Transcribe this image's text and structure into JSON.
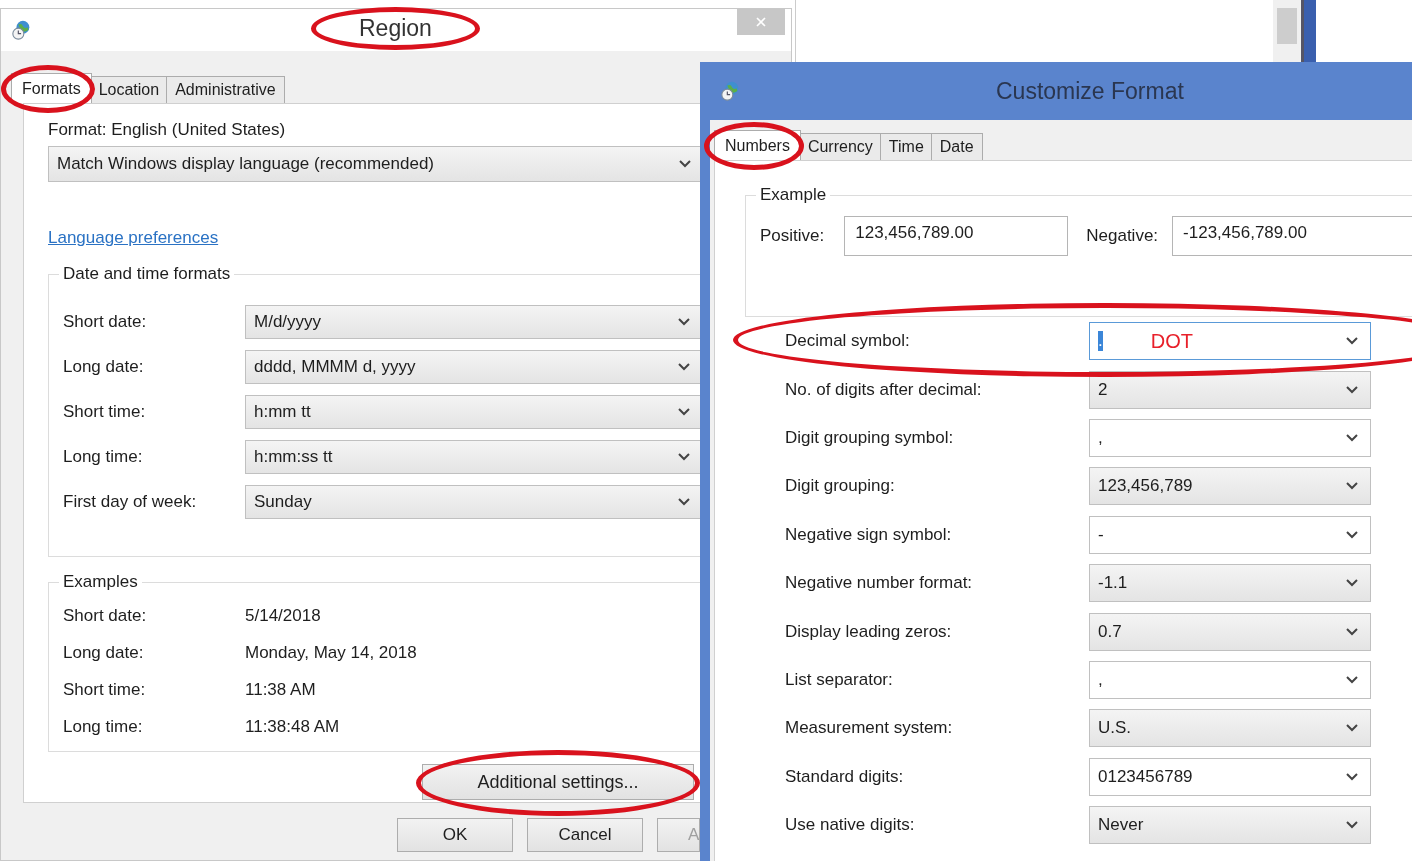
{
  "region_window": {
    "title": "Region",
    "title_circled": true,
    "tabs": [
      {
        "label": "Formats",
        "selected": true,
        "circled": true
      },
      {
        "label": "Location",
        "selected": false,
        "circled": false
      },
      {
        "label": "Administrative",
        "selected": false,
        "circled": false
      }
    ],
    "format_label": "Format: English (United States)",
    "format_value": "Match Windows display language (recommended)",
    "link": "Language preferences",
    "date_time_group": {
      "title": "Date and time formats",
      "rows": [
        {
          "label": "Short date:",
          "value": "M/d/yyyy"
        },
        {
          "label": "Long date:",
          "value": "dddd, MMMM d, yyyy"
        },
        {
          "label": "Short time:",
          "value": "h:mm tt"
        },
        {
          "label": "Long time:",
          "value": "h:mm:ss tt"
        },
        {
          "label": "First day of week:",
          "value": "Sunday"
        }
      ]
    },
    "examples_group": {
      "title": "Examples",
      "rows": [
        {
          "label": "Short date:",
          "value": "5/14/2018"
        },
        {
          "label": "Long date:",
          "value": "Monday, May 14, 2018"
        },
        {
          "label": "Short time:",
          "value": "11:38 AM"
        },
        {
          "label": "Long time:",
          "value": "11:38:48 AM"
        }
      ]
    },
    "additional_button": {
      "label": "Additional settings...",
      "circled": true
    },
    "buttons": [
      {
        "label": "OK",
        "disabled": false
      },
      {
        "label": "Cancel",
        "disabled": false
      },
      {
        "label": "A",
        "disabled": true
      }
    ]
  },
  "customize_window": {
    "title": "Customize Format",
    "tabs": [
      {
        "label": "Numbers",
        "selected": true,
        "circled": true
      },
      {
        "label": "Currency",
        "selected": false,
        "circled": false
      },
      {
        "label": "Time",
        "selected": false,
        "circled": false
      },
      {
        "label": "Date",
        "selected": false,
        "circled": false
      }
    ],
    "example_group": {
      "title": "Example",
      "positive_label": "Positive:",
      "positive_value": "123,456,789.00",
      "negative_label": "Negative:",
      "negative_value": "-123,456,789.00"
    },
    "settings": [
      {
        "label": "Decimal symbol:",
        "value": ".",
        "kind": "editable",
        "focused": true,
        "circled": true,
        "note": "DOT"
      },
      {
        "label": "No. of digits after decimal:",
        "value": "2",
        "kind": "list",
        "focused": false,
        "circled": false
      },
      {
        "label": "Digit grouping symbol:",
        "value": ",",
        "kind": "editable",
        "focused": false,
        "circled": false
      },
      {
        "label": "Digit grouping:",
        "value": "123,456,789",
        "kind": "list",
        "focused": false,
        "circled": false
      },
      {
        "label": "Negative sign symbol:",
        "value": "-",
        "kind": "editable",
        "focused": false,
        "circled": false
      },
      {
        "label": "Negative number format:",
        "value": "-1.1",
        "kind": "list",
        "focused": false,
        "circled": false
      },
      {
        "label": "Display leading zeros:",
        "value": "0.7",
        "kind": "list",
        "focused": false,
        "circled": false
      },
      {
        "label": "List separator:",
        "value": ",",
        "kind": "editable",
        "focused": false,
        "circled": false
      },
      {
        "label": "Measurement system:",
        "value": "U.S.",
        "kind": "list",
        "focused": false,
        "circled": false
      },
      {
        "label": "Standard digits:",
        "value": "0123456789",
        "kind": "editable",
        "focused": false,
        "circled": false
      },
      {
        "label": "Use native digits:",
        "value": "Never",
        "kind": "list",
        "focused": false,
        "circled": false
      }
    ]
  }
}
